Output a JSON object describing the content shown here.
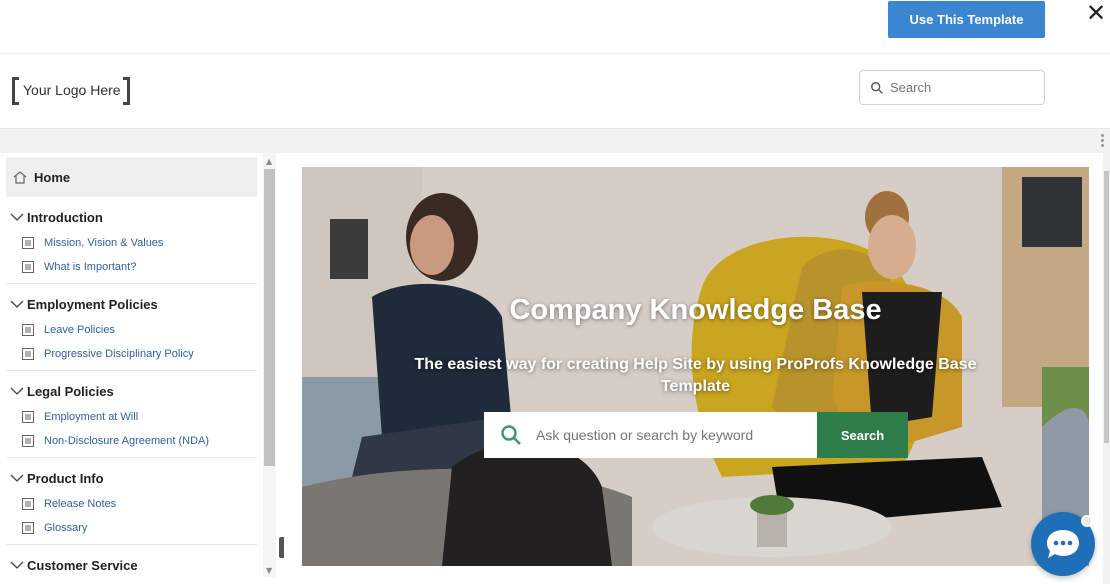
{
  "topbar": {
    "use_template_label": "Use This Template",
    "close_glyph": "✕"
  },
  "header": {
    "logo_text": "Your Logo Here",
    "search_placeholder": "Search"
  },
  "sidebar": {
    "home_label": "Home",
    "sections": [
      {
        "title": "Introduction",
        "items": [
          "Mission, Vision & Values",
          "What is Important?"
        ]
      },
      {
        "title": "Employment Policies",
        "items": [
          "Leave Policies",
          "Progressive Disciplinary Policy"
        ]
      },
      {
        "title": "Legal Policies",
        "items": [
          "Employment at Will",
          "Non-Disclosure Agreement (NDA)"
        ]
      },
      {
        "title": "Product Info",
        "items": [
          "Release Notes",
          "Glossary"
        ]
      },
      {
        "title": "Customer Service",
        "items": []
      }
    ]
  },
  "hero": {
    "title": "Company Knowledge Base",
    "subtitle": "The easiest way for creating Help Site by using ProProfs Knowledge Base Template",
    "search_placeholder": "Ask question or search by keyword",
    "search_button": "Search"
  },
  "colors": {
    "primary_button": "#3a86d1",
    "hero_search_button": "#2e7d4a",
    "nav_link": "#2f5fa6",
    "chat_bubble": "#1f6fb8"
  },
  "icons": {
    "close": "close-icon",
    "search": "search-icon",
    "home": "home-icon",
    "chevron": "chevron-down-icon",
    "doc": "document-icon",
    "chat": "chat-icon",
    "collapse": "chevron-left-icon"
  }
}
